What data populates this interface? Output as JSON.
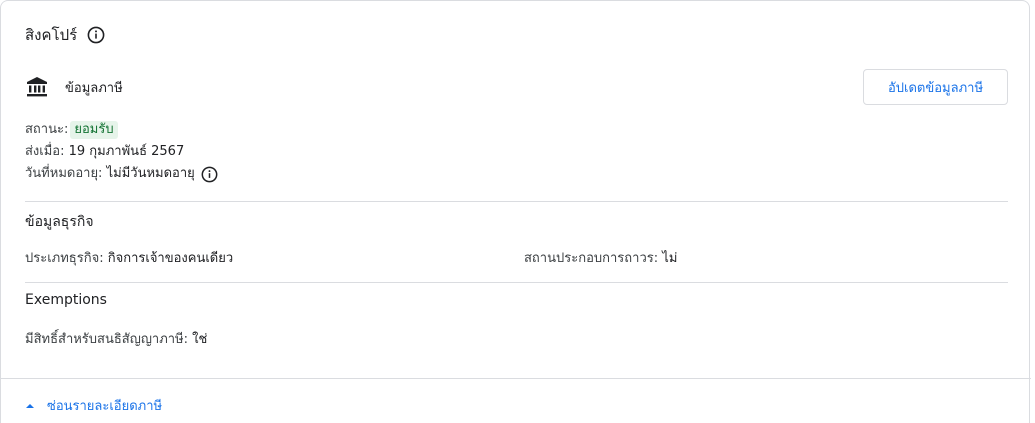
{
  "header": {
    "country": "สิงคโปร์"
  },
  "tax": {
    "label": "ข้อมูลภาษี",
    "update_button": "อัปเดตข้อมูลภาษี"
  },
  "status": {
    "status_label": "สถานะ:",
    "status_value": "ยอมรับ",
    "sent_label": "ส่งเมื่อ:",
    "sent_value": "19 กุมภาพันธ์ 2567",
    "expiry_label": "วันที่หมดอายุ:",
    "expiry_value": "ไม่มีวันหมดอายุ"
  },
  "business": {
    "title": "ข้อมูลธุรกิจ",
    "type_label": "ประเภทธุรกิจ:",
    "type_value": "กิจการเจ้าของคนเดียว",
    "establishment_label": "สถานประกอบการถาวร:",
    "establishment_value": "ไม่"
  },
  "exemptions": {
    "title": "Exemptions",
    "treaty_label": "มีสิทธิ์สำหรับสนธิสัญญาภาษี:",
    "treaty_value": "ใช่"
  },
  "footer": {
    "toggle_label": "ซ่อนรายละเอียดภาษี"
  },
  "colors": {
    "accent": "#1a73e8",
    "success_bg": "#e6f4ea",
    "success_text": "#137333",
    "divider": "#dadce0"
  },
  "icons": {
    "info": "info-icon",
    "bank": "bank-icon",
    "caret": "caret-up-icon"
  }
}
